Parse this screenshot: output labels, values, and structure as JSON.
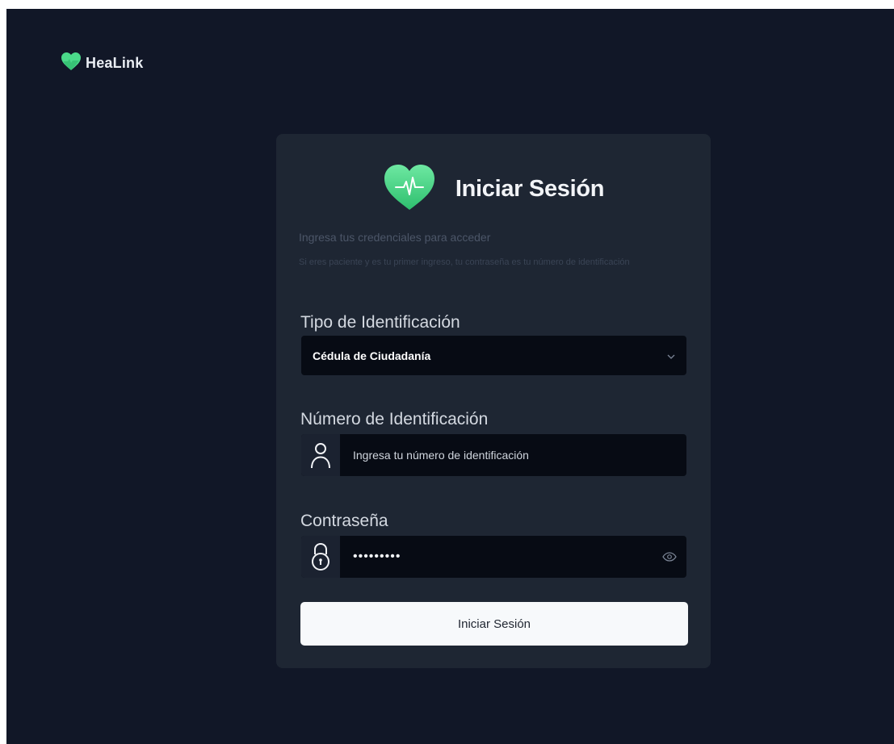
{
  "brand": {
    "name": "HeaLink",
    "logo_icon": "heart-icon"
  },
  "login": {
    "title": "Iniciar Sesión",
    "subtitle": "Ingresa tus credenciales para acceder",
    "hint": "Si eres paciente y es tu primer ingreso, tu contraseña es tu número de identificación",
    "id_type": {
      "label": "Tipo de Identificación",
      "selected": "Cédula de Ciudadanía"
    },
    "id_number": {
      "label": "Número de Identificación",
      "placeholder": "Ingresa tu número de identificación",
      "icon": "user-icon"
    },
    "password": {
      "label": "Contraseña",
      "value": "•••••••••",
      "icon": "lock-icon",
      "toggle_icon": "eye-icon"
    },
    "submit_label": "Iniciar Sesión"
  },
  "colors": {
    "background": "#111727",
    "card": "#1e2633",
    "field": "#070b14",
    "accent_green": "#48d987",
    "button": "#f7f9fb"
  }
}
